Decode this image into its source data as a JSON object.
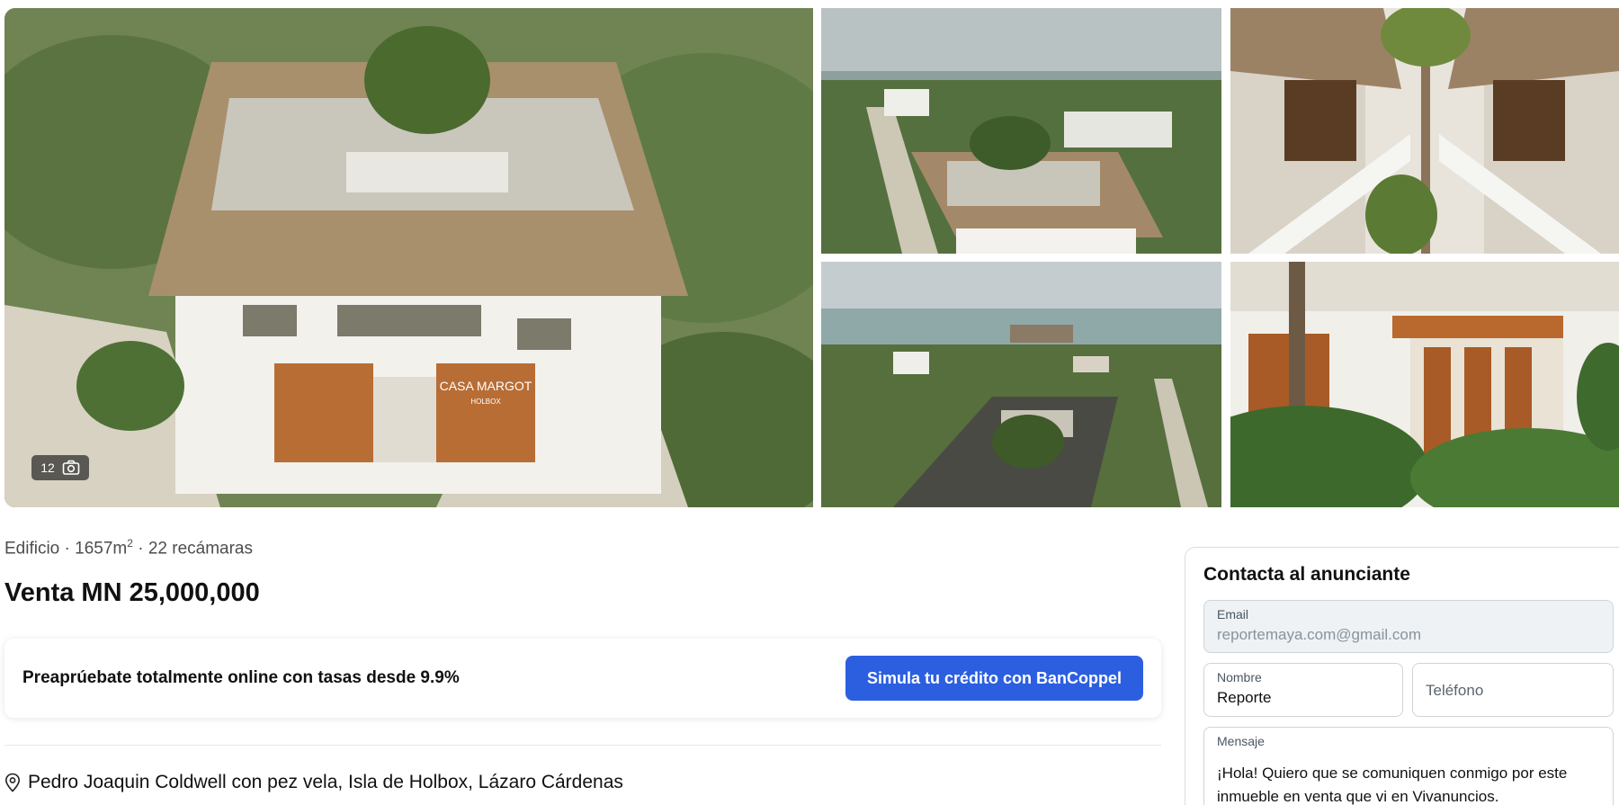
{
  "gallery": {
    "photo_count": "12",
    "photos": [
      {
        "name": "main-photo",
        "sign_text": "CASA MARGOT",
        "sign_subtext": "HOLBOX"
      },
      {
        "name": "aerial-view-photo"
      },
      {
        "name": "corridor-photo"
      },
      {
        "name": "coastal-view-photo"
      },
      {
        "name": "garden-facade-photo"
      }
    ]
  },
  "listing": {
    "type": "Edificio",
    "area": "1657m",
    "area_unit_sup": "2",
    "bedrooms": "22 recámaras",
    "summary_sep": " · ",
    "price": "Venta MN 25,000,000",
    "address": "Pedro Joaquin Coldwell con pez vela, Isla de Holbox, Lázaro Cárdenas"
  },
  "credit_banner": {
    "text": "Preaprúebate totalmente online con tasas desde 9.9%",
    "button_label": "Simula tu crédito con BanCoppel"
  },
  "contact": {
    "title": "Contacta al anunciante",
    "email_label": "Email",
    "email_value": "reportemaya.com@gmail.com",
    "name_label": "Nombre",
    "name_value": "Reporte",
    "phone_placeholder": "Teléfono",
    "message_label": "Mensaje",
    "message_value": "¡Hola! Quiero que se comuniquen conmigo por este inmueble en venta que vi en Vivanuncios."
  },
  "colors": {
    "accent": "#2c5fe0",
    "field_border": "#cfd4da",
    "email_bg": "#eef2f5"
  },
  "icons": {
    "photo_count": "camera-icon",
    "address": "map-pin-icon"
  }
}
